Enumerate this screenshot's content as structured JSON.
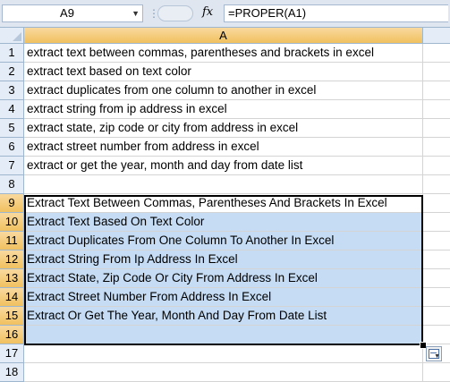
{
  "formula_bar": {
    "name_box": "A9",
    "fx_label": "fx",
    "formula": "=PROPER(A1)"
  },
  "grid": {
    "column_header": "A",
    "rows": [
      {
        "num": "1",
        "text": "extract text between commas, parentheses and brackets in excel"
      },
      {
        "num": "2",
        "text": "extract text based on text color"
      },
      {
        "num": "3",
        "text": "extract duplicates from one column to another in excel"
      },
      {
        "num": "4",
        "text": "extract string from ip address in excel"
      },
      {
        "num": "5",
        "text": "extract state, zip code or city from address in excel"
      },
      {
        "num": "6",
        "text": "extract street number from address in excel"
      },
      {
        "num": "7",
        "text": "extract or get the year, month and day from date list"
      },
      {
        "num": "8",
        "text": ""
      },
      {
        "num": "9",
        "text": "Extract Text Between Commas, Parentheses And Brackets In Excel"
      },
      {
        "num": "10",
        "text": "Extract Text Based On Text Color"
      },
      {
        "num": "11",
        "text": "Extract Duplicates From One Column To Another In Excel"
      },
      {
        "num": "12",
        "text": "Extract String From Ip Address In Excel"
      },
      {
        "num": "13",
        "text": "Extract State, Zip Code Or City From Address In Excel"
      },
      {
        "num": "14",
        "text": "Extract Street Number From Address In Excel"
      },
      {
        "num": "15",
        "text": "Extract Or Get The Year, Month And Day From Date List"
      },
      {
        "num": "16",
        "text": ""
      },
      {
        "num": "17",
        "text": ""
      },
      {
        "num": "18",
        "text": ""
      }
    ]
  },
  "colors": {
    "selection": "#c5dcf4",
    "header_highlight": "#f1c15f",
    "header": "#e4ecf7"
  }
}
